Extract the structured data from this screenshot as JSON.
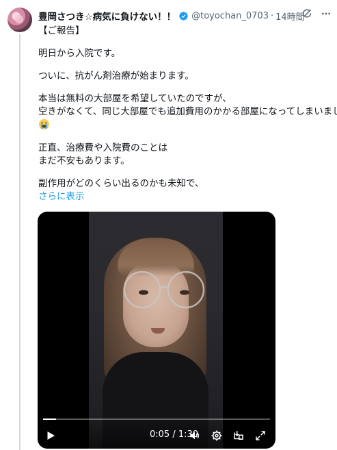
{
  "author": {
    "name": "豊岡さつき☆病気に負けない！！",
    "handle": "@toyochan_0703",
    "separator": "·",
    "time": "14時間"
  },
  "tweet": {
    "lines": [
      "【ご報告】",
      "",
      "明日から入院です。",
      "",
      "ついに、抗がん剤治療が始まります。",
      "",
      "本当は無料の大部屋を希望していたのですが、",
      "空きがなくて、同じ大部屋でも追加費用のかかる部屋になってしまいました",
      "",
      "正直、治療費や入院費のことは",
      "まだ不安もあります。",
      "",
      "副作用がどのくらい出るのかも未知で、"
    ],
    "show_more": "さらに表示"
  },
  "video": {
    "current_time": "0:05",
    "duration": "1:30",
    "time_separator": " / ",
    "progress": 0.056
  },
  "icons": {
    "verified": "verified-badge-icon",
    "grok": "grok-icon",
    "more": "more-icon",
    "play": "play-icon",
    "volume": "volume-icon",
    "settings": "settings-icon",
    "pip": "picture-in-picture-icon",
    "fullscreen": "fullscreen-icon",
    "emoji": "loudly-crying-face-emoji"
  },
  "colors": {
    "accent": "#1d9bf0",
    "secondary_text": "#536471"
  }
}
